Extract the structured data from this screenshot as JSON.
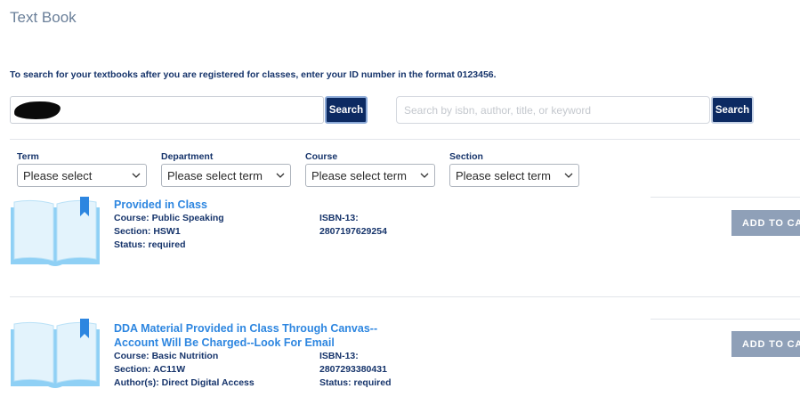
{
  "page": {
    "title": "Text Book"
  },
  "instructions": "To search for your textbooks after you are registered for classes, enter your ID number in the format 0123456.",
  "id_search": {
    "button_label": "Search"
  },
  "keyword_search": {
    "placeholder": "Search by isbn, author, title, or keyword",
    "button_label": "Search"
  },
  "filters": [
    {
      "label": "Term",
      "value": "Please select"
    },
    {
      "label": "Department",
      "value": "Please select term"
    },
    {
      "label": "Course",
      "value": "Please select term"
    },
    {
      "label": "Section",
      "value": "Please select term"
    }
  ],
  "books": [
    {
      "title": "Provided in Class",
      "course": "Course: Public Speaking",
      "section": "Section: HSW1",
      "extra": "Status: required",
      "isbn_label": "ISBN-13:",
      "isbn": "2807197629254",
      "status_right": "",
      "cart_label": "ADD TO CART"
    },
    {
      "title_line1": "DDA Material Provided in Class Through Canvas--",
      "title_line2": "Account Will Be Charged--Look For Email",
      "course": "Course: Basic Nutrition",
      "section": "Section: AC11W",
      "extra": "Author(s): Direct Digital Access",
      "isbn_label": "ISBN-13:",
      "isbn": "2807293380431",
      "status_right": "Status: required",
      "cart_label": "ADD TO CART"
    }
  ],
  "colors": {
    "primary": "#0c2a62",
    "link": "#2d86e0",
    "book_icon": "#8fd0f5",
    "cart_disabled": "#8fa0b8"
  }
}
